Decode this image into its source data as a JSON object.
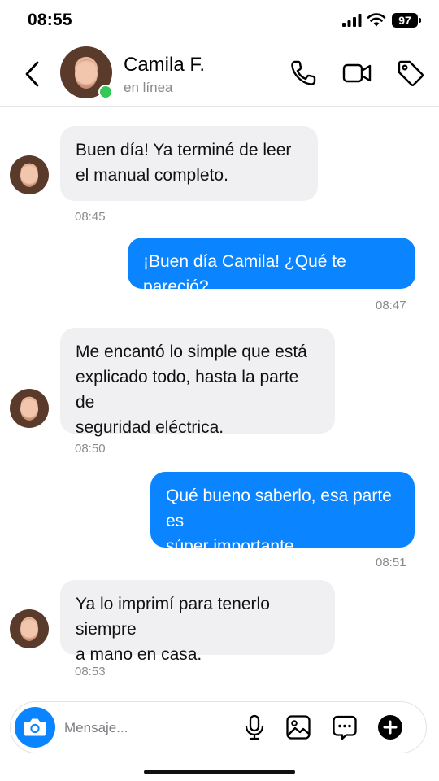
{
  "status_bar": {
    "time": "08:55",
    "battery": "97"
  },
  "header": {
    "name": "Camila F.",
    "status": "en línea"
  },
  "messages": [
    {
      "dir": "in",
      "lines": [
        "Buen día! Ya terminé de leer",
        "el manual completo."
      ],
      "time": "08:45"
    },
    {
      "dir": "out",
      "lines": [
        "¡Buen día Camila! ¿Qué te pareció?"
      ],
      "time": "08:47"
    },
    {
      "dir": "in",
      "lines": [
        "Me encantó lo simple que está",
        "explicado todo, hasta la parte de",
        "seguridad eléctrica."
      ],
      "time": "08:50"
    },
    {
      "dir": "out",
      "lines": [
        "Qué bueno saberlo, esa parte es",
        "súper importante."
      ],
      "time": "08:51"
    },
    {
      "dir": "in",
      "lines": [
        "Ya lo imprimí para tenerlo siempre",
        "a mano en casa."
      ],
      "time": "08:53"
    }
  ],
  "composer": {
    "placeholder": "Mensaje..."
  },
  "colors": {
    "accent": "#0a84ff",
    "incoming_bubble": "#f0f0f2",
    "online": "#34c759"
  }
}
